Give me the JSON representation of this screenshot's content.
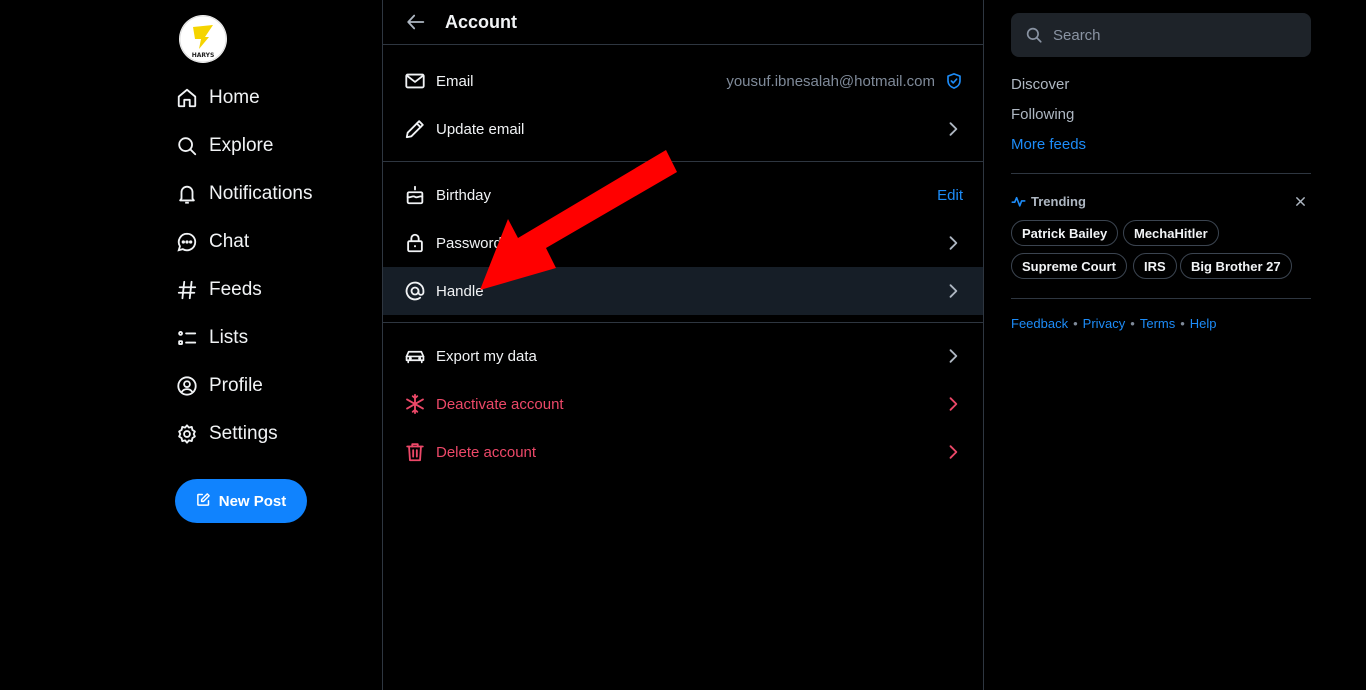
{
  "avatar": {
    "text": "HARYS"
  },
  "nav": {
    "items": [
      {
        "label": "Home",
        "icon": "home-icon"
      },
      {
        "label": "Explore",
        "icon": "search-icon"
      },
      {
        "label": "Notifications",
        "icon": "bell-icon"
      },
      {
        "label": "Chat",
        "icon": "chat-icon"
      },
      {
        "label": "Feeds",
        "icon": "hash-icon"
      },
      {
        "label": "Lists",
        "icon": "list-icon"
      },
      {
        "label": "Profile",
        "icon": "profile-icon"
      },
      {
        "label": "Settings",
        "icon": "gear-icon"
      }
    ],
    "new_post": "New Post"
  },
  "account": {
    "title": "Account",
    "email_label": "Email",
    "email_value": "yousuf.ibnesalah@hotmail.com",
    "update_email": "Update email",
    "birthday": "Birthday",
    "birthday_action": "Edit",
    "password": "Password",
    "handle": "Handle",
    "export": "Export my data",
    "deactivate": "Deactivate account",
    "delete": "Delete account"
  },
  "right": {
    "search_placeholder": "Search",
    "feeds": [
      "Discover",
      "Following",
      "More feeds"
    ],
    "trending_title": "Trending",
    "trending": [
      "Patrick Bailey",
      "MechaHitler",
      "Supreme Court",
      "IRS",
      "Big Brother 27"
    ],
    "footer": [
      "Feedback",
      "Privacy",
      "Terms",
      "Help"
    ]
  },
  "colors": {
    "accent": "#1083fe",
    "link": "#1d8cf8",
    "danger": "#ec4868",
    "annotation_arrow": "#ff0000"
  }
}
